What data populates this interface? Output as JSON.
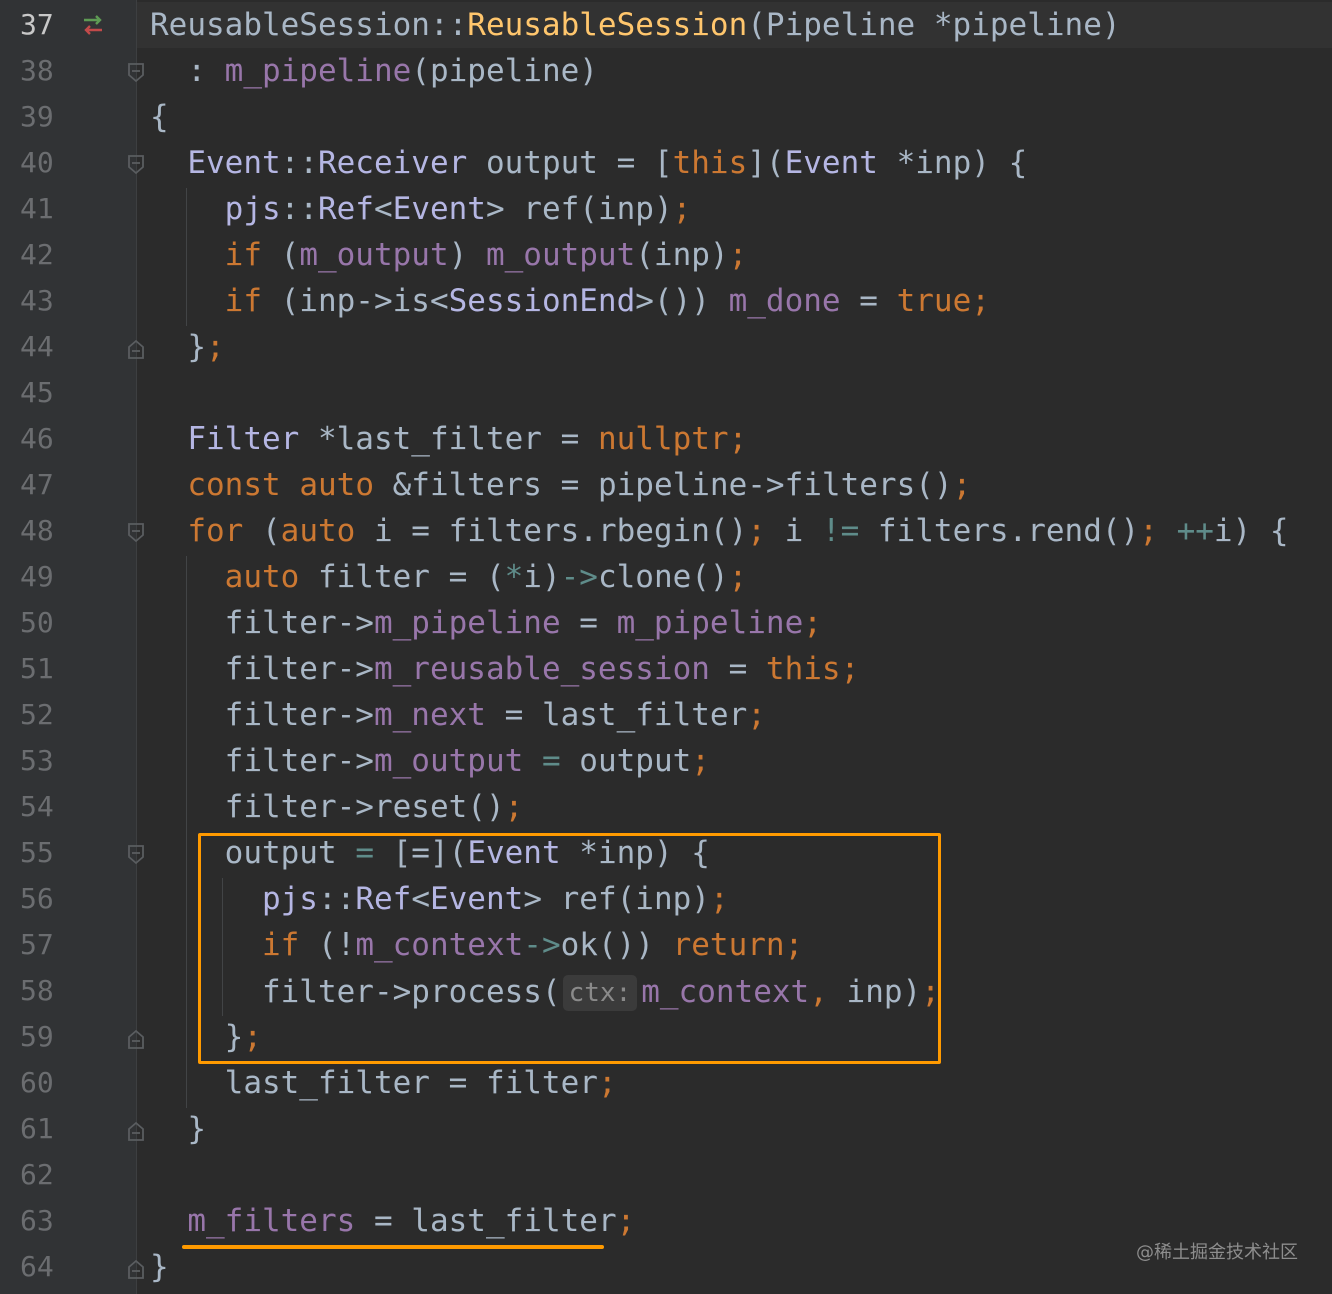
{
  "editor": {
    "line_numbers": [
      "37",
      "38",
      "39",
      "40",
      "41",
      "42",
      "43",
      "44",
      "45",
      "46",
      "47",
      "48",
      "49",
      "50",
      "51",
      "52",
      "53",
      "54",
      "55",
      "56",
      "57",
      "58",
      "59",
      "60",
      "61",
      "62",
      "63",
      "64"
    ],
    "active_line": "37"
  },
  "inlay_hint": "ctx:",
  "watermark": "@稀土掘金技术社区",
  "colors": {
    "background": "#2b2b2b",
    "gutter": "#313335",
    "keyword": "#cc7832",
    "function": "#ffc66d",
    "field": "#9876aa",
    "type": "#b5b6e3",
    "text": "#a9b7c6",
    "highlight_box": "#ff9a00"
  },
  "icons": {
    "gutter_vcs": "vcs-change-arrows-icon",
    "fold": "fold-marker-icon"
  }
}
